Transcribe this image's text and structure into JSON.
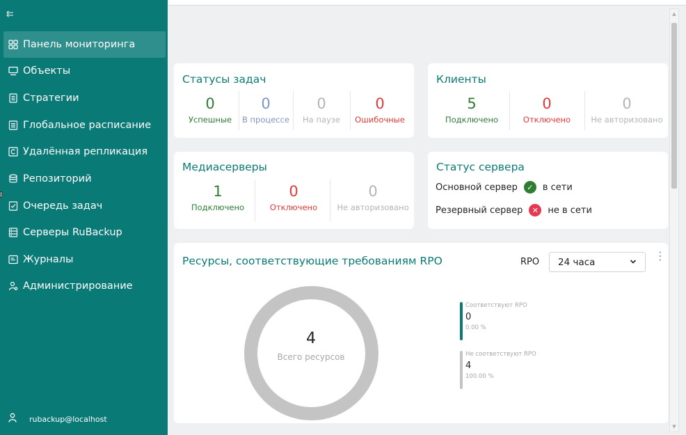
{
  "sidebar": {
    "collapse_icon": "collapse-icon",
    "items": [
      {
        "label": "Панель мониторинга",
        "icon": "dashboard-icon",
        "active": true
      },
      {
        "label": "Объекты",
        "icon": "monitor-icon"
      },
      {
        "label": "Стратегии",
        "icon": "document-icon"
      },
      {
        "label": "Глобальное расписание",
        "icon": "schedule-icon"
      },
      {
        "label": "Удалённая репликация",
        "icon": "replication-icon"
      },
      {
        "label": "Репозиторий",
        "icon": "database-icon"
      },
      {
        "label": "Очередь задач",
        "icon": "queue-icon"
      },
      {
        "label": "Серверы RuBackup",
        "icon": "server-icon"
      },
      {
        "label": "Журналы",
        "icon": "log-icon"
      },
      {
        "label": "Администрирование",
        "icon": "admin-icon"
      }
    ],
    "user": "rubackup@localhost"
  },
  "tasks": {
    "title": "Статусы задач",
    "stats": [
      {
        "value": "0",
        "label": "Успешные"
      },
      {
        "value": "0",
        "label": "В процессе"
      },
      {
        "value": "0",
        "label": "На паузе"
      },
      {
        "value": "0",
        "label": "Ошибочные"
      }
    ]
  },
  "clients": {
    "title": "Клиенты",
    "stats": [
      {
        "value": "5",
        "label": "Подключено"
      },
      {
        "value": "0",
        "label": "Отключено"
      },
      {
        "value": "0",
        "label": "Не авторизовано"
      }
    ]
  },
  "media": {
    "title": "Медиасерверы",
    "stats": [
      {
        "value": "1",
        "label": "Подключено"
      },
      {
        "value": "0",
        "label": "Отключено"
      },
      {
        "value": "0",
        "label": "Не авторизовано"
      }
    ]
  },
  "server_status": {
    "title": "Статус сервера",
    "primary": {
      "label": "Основной сервер",
      "status": "в сети"
    },
    "backup": {
      "label": "Резервный сервер",
      "status": "не в сети"
    }
  },
  "rpo": {
    "title": "Ресурсы, соответствующие требованиям RPO",
    "select_label": "RPO",
    "select_value": "24 часа",
    "total": "4",
    "total_label": "Всего ресурсов",
    "legend": [
      {
        "title": "Соответствуют RPO",
        "value": "0",
        "percent": "0.00 %",
        "color": "#0a7a77"
      },
      {
        "title": "Не соответствуют RPO",
        "value": "4",
        "percent": "100.00 %",
        "color": "#c4c4c4"
      }
    ]
  },
  "colors": {
    "accent": "#0a7a77",
    "success": "#2e7d32",
    "error": "#e53935",
    "progress": "#7f95c8",
    "muted": "#b2b5b7"
  }
}
